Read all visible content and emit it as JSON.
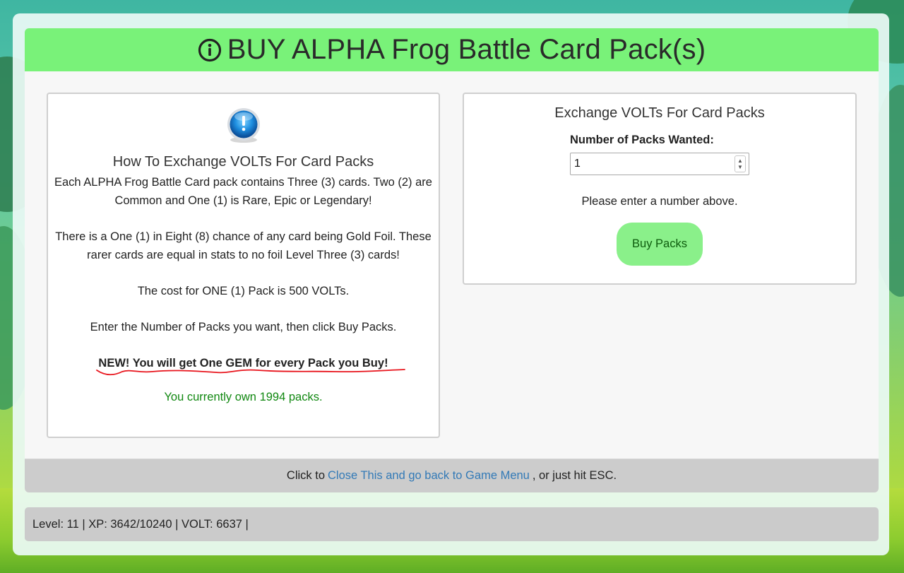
{
  "modal": {
    "title": "BUY ALPHA Frog Battle Card Pack(s)",
    "header_icon": "info-circle-icon"
  },
  "left_panel": {
    "icon": "info-orb-icon",
    "heading": "How To Exchange VOLTs For Card Packs",
    "para1": "Each ALPHA Frog Battle Card pack contains Three (3) cards. Two (2) are Common and One (1) is Rare, Epic or Legendary!",
    "para2": "There is a One (1) in Eight (8) chance of any card being Gold Foil. These rarer cards are equal in stats to no foil Level Three (3) cards!",
    "para3": "The cost for ONE (1) Pack is 500 VOLTs.",
    "para4": "Enter the Number of Packs you want, then click Buy Packs.",
    "new_notice": "NEW! You will get One GEM for every Pack you Buy!",
    "owned": "You currently own 1994 packs."
  },
  "right_panel": {
    "heading": "Exchange VOLTs For Card Packs",
    "field_label": "Number of Packs Wanted:",
    "field_value": "1",
    "hint": "Please enter a number above.",
    "buy_label": "Buy Packs"
  },
  "footer": {
    "prefix": "Click to",
    "link": "Close This and go back to Game Menu",
    "suffix": ", or just hit ESC."
  },
  "status_bar": {
    "text": "Level: 11 | XP: 3642/10240 | VOLT: 6637 |"
  },
  "colors": {
    "header_bg": "#79f279",
    "button_bg": "#8af08a",
    "owned_text": "#118811",
    "link": "#337ab7",
    "annotation": "#e8141c"
  }
}
